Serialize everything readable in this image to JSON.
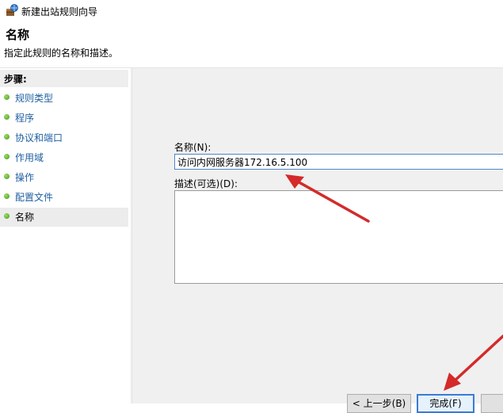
{
  "window": {
    "title": "新建出站规则向导"
  },
  "header": {
    "title": "名称",
    "subtitle": "指定此规则的名称和描述。"
  },
  "steps": {
    "heading": "步骤:",
    "items": [
      {
        "label": "规则类型"
      },
      {
        "label": "程序"
      },
      {
        "label": "协议和端口"
      },
      {
        "label": "作用域"
      },
      {
        "label": "操作"
      },
      {
        "label": "配置文件"
      },
      {
        "label": "名称",
        "active": true
      }
    ]
  },
  "form": {
    "name_label": "名称(N):",
    "name_value": "访问内网服务器172.16.5.100",
    "description_label": "描述(可选)(D):",
    "description_value": ""
  },
  "buttons": {
    "back_label": "< 上一步(B)",
    "finish_label": "完成(F)",
    "cancel_label": ""
  },
  "colors": {
    "annotation_arrow": "#d42a2a",
    "focus_border": "#4f86c8",
    "step_link": "#1f5fa0",
    "step_bullet": "#3f9d1c"
  }
}
